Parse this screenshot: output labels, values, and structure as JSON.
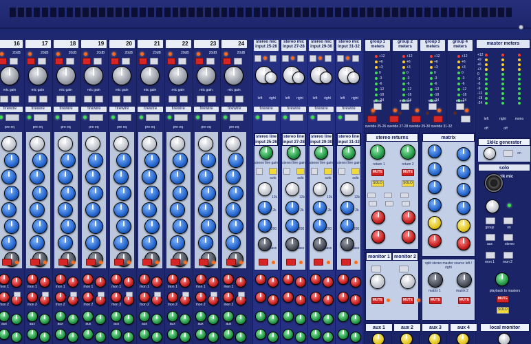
{
  "console": {
    "channel_numbers": [
      "16",
      "17",
      "18",
      "19",
      "20",
      "21",
      "22",
      "23",
      "24"
    ],
    "mono_labels": {
      "mic_gain": "mic gain",
      "firewire": "firewire",
      "firewire_direct": "firewire & direct out",
      "pre_eq": "pre eq",
      "post_eq": "post eq",
      "input": "input",
      "eq": "eq",
      "mon1": "mon 1",
      "mon2": "mon 2",
      "pre": "pre",
      "aux": "aux",
      "db20": "20dB",
      "phase": "Ø",
      "pad": "pad",
      "hpf": "hpf"
    },
    "stereo_channels": [
      {
        "header": "stereo mic input 25-26",
        "line": "stereo line input 25-26"
      },
      {
        "header": "stereo mic input 27-28",
        "line": "stereo line input 27-28"
      },
      {
        "header": "stereo mic input 29-30",
        "line": "stereo line input 29-30"
      },
      {
        "header": "stereo mic input 31-32",
        "line": "stereo line input 31-32"
      }
    ],
    "stereo_labels": {
      "left": "left",
      "right": "right",
      "line_gain": "stereo line gain",
      "channel": "channel",
      "mono": "mono",
      "solo": "solo",
      "treble": "treble",
      "k12": "12k",
      "k2": "2k",
      "hz200": "200",
      "bass": "bass",
      "hz75": "75"
    },
    "group_meters": [
      "group 1 meters",
      "group 2 meters",
      "group 3 meters",
      "group 4 meters"
    ],
    "master_meters": "master meters",
    "meter_scale": [
      "+12",
      "+6",
      "+3",
      "0",
      "-3",
      "-6",
      "-12",
      "-18",
      "-24"
    ],
    "master_scale": [
      "+12",
      "+9",
      "+6",
      "+3",
      "0",
      "-3",
      "-6",
      "-9",
      "-12",
      "-18",
      "-24"
    ],
    "master_lr": [
      "left",
      "right",
      "mono"
    ],
    "meter_sources": [
      "group",
      "monitor",
      "matrix",
      "mono"
    ],
    "overide_labels": [
      "overide 25-26",
      "overide 27-28",
      "overide 29-30",
      "overide 31-32"
    ],
    "output_labels": [
      "firewire",
      "firewire",
      "firewire",
      "firewire",
      "firewire",
      "firewire",
      "firewire"
    ],
    "stereo_returns": "stereo returns",
    "return1": "return 1",
    "return2": "return 2",
    "matrix": "matrix",
    "mute": "MUTE",
    "solo": "SOLO",
    "monitor1": "monitor 1",
    "monitor2": "monitor 2",
    "stereo_master": "stereo master",
    "split_stereo": "split stereo master source left / right",
    "matrix1": "matrix 1",
    "matrix2": "matrix 2",
    "generator": "1kHz generator",
    "on": "on",
    "off": "off",
    "solo_section": "solo",
    "talk_mic": "talk mic",
    "group_btn": "group",
    "aux_btn": "aux",
    "mon1_btn": "mon 1",
    "mon2_btn": "mon 2",
    "stereo_btn": "stereo",
    "master_btn": "master",
    "playback": "playback to masters",
    "aux_footer": [
      "aux 1",
      "aux 2",
      "aux 3",
      "aux 4"
    ],
    "local_monitor": "local monitor"
  }
}
